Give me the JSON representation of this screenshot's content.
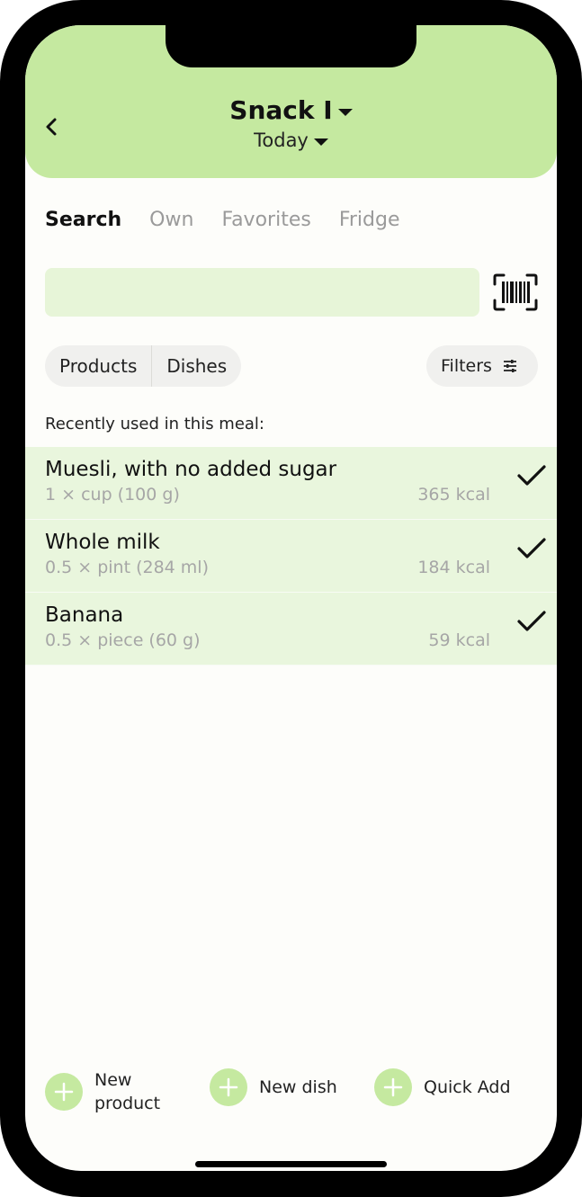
{
  "header": {
    "meal_title": "Snack I",
    "date_title": "Today"
  },
  "tabs": [
    {
      "label": "Search",
      "active": true
    },
    {
      "label": "Own",
      "active": false
    },
    {
      "label": "Favorites",
      "active": false
    },
    {
      "label": "Fridge",
      "active": false
    }
  ],
  "search": {
    "value": "",
    "placeholder": ""
  },
  "segments": {
    "products_label": "Products",
    "dishes_label": "Dishes"
  },
  "filters_label": "Filters",
  "section_label": "Recently used in this meal:",
  "recent_items": [
    {
      "name": "Muesli, with no added sugar",
      "portion": "1 × cup (100 g)",
      "kcal": "365 kcal",
      "checked": true
    },
    {
      "name": "Whole milk",
      "portion": "0.5 × pint (284 ml)",
      "kcal": "184 kcal",
      "checked": true
    },
    {
      "name": "Banana",
      "portion": "0.5 × piece (60 g)",
      "kcal": "59 kcal",
      "checked": true
    }
  ],
  "bottom_actions": {
    "new_product": "New product",
    "new_dish": "New dish",
    "quick_add": "Quick Add"
  },
  "colors": {
    "accent": "#c5e9a0",
    "search_bg": "#e7f5d8",
    "row_bg": "#e9f6dd"
  },
  "icons": {
    "back": "chevron-left-icon",
    "barcode": "barcode-scan-icon",
    "filters": "sliders-icon",
    "check": "check-icon",
    "plus": "plus-icon"
  }
}
